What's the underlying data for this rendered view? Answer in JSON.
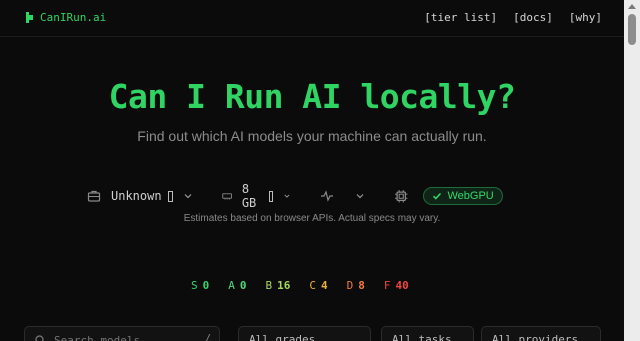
{
  "header": {
    "brand": "CanIRun.ai",
    "nav": [
      "[tier list]",
      "[docs]",
      "[why]"
    ]
  },
  "hero": {
    "title": "Can I Run AI locally?",
    "subtitle": "Find out which AI models your machine can actually run."
  },
  "specs": {
    "cpu_value": "Unknown",
    "ram_value": "8 GB",
    "webgpu_label": "WebGPU",
    "note": "Estimates based on browser APIs. Actual specs may vary."
  },
  "grades": [
    {
      "letter": "S",
      "count": "0",
      "color": "#37d46a"
    },
    {
      "letter": "A",
      "count": "0",
      "color": "#4fd97a"
    },
    {
      "letter": "B",
      "count": "16",
      "color": "#a4d95a"
    },
    {
      "letter": "C",
      "count": "4",
      "color": "#e8b23a"
    },
    {
      "letter": "D",
      "count": "8",
      "color": "#ef7a3a"
    },
    {
      "letter": "F",
      "count": "40",
      "color": "#ef4444"
    }
  ],
  "filters": {
    "search_placeholder": "Search models...",
    "search_shortcut": "/",
    "grades_select": "All grades",
    "tasks_select": "All tasks",
    "providers_select": "All providers"
  },
  "colors": {
    "accent": "#2fd463",
    "background": "#0b0b0b"
  }
}
